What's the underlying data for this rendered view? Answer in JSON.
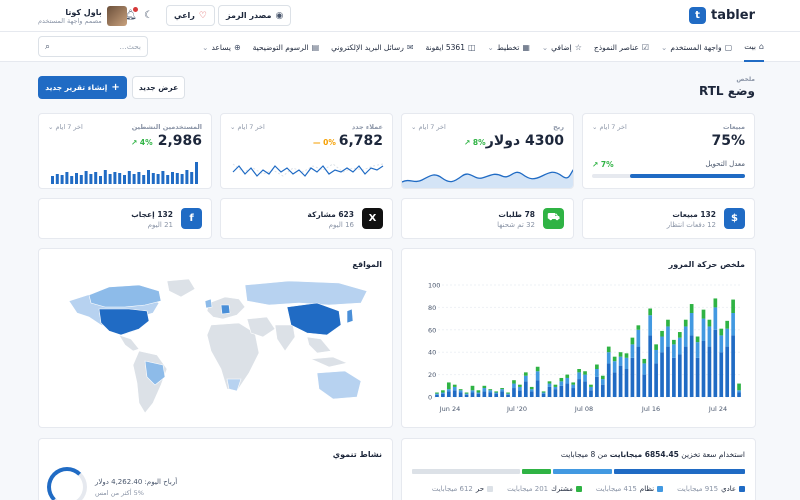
{
  "brand": {
    "name": "tabler",
    "mark": "t"
  },
  "header": {
    "source_btn": "مصدر الرمز",
    "sponsor_btn": "راعي",
    "user": {
      "name": "باول كوتا",
      "role": "مصمم واجهة المستخدم"
    }
  },
  "nav": {
    "items": [
      {
        "label": "بيت",
        "icon": "home-icon",
        "glyph": "⌂"
      },
      {
        "label": "واجهة المستخدم",
        "icon": "package-icon",
        "glyph": "▢",
        "dropdown": true
      },
      {
        "label": "عناصر النموذج",
        "icon": "checkbox-icon",
        "glyph": "☑"
      },
      {
        "label": "إضافي",
        "icon": "star-icon",
        "glyph": "☆",
        "dropdown": true
      },
      {
        "label": "تخطيط",
        "icon": "layout-icon",
        "glyph": "▦",
        "dropdown": true
      },
      {
        "label": "5361 ايقونة",
        "icon": "ghost-icon",
        "glyph": "◫"
      },
      {
        "label": "رسائل البريد الإلكتروني",
        "icon": "mail-icon",
        "glyph": "✉"
      },
      {
        "label": "الرسوم التوضيحية",
        "icon": "file-icon",
        "glyph": "▤"
      },
      {
        "label": "يساعد",
        "icon": "lifebuoy-icon",
        "glyph": "⊕",
        "dropdown": true
      }
    ],
    "search_placeholder": "بحث..."
  },
  "page": {
    "pretitle": "ملخص",
    "title": "وضع RTL",
    "btn_new": "إنشاء تقرير جديد",
    "btn_view": "عرض جديد"
  },
  "stats": [
    {
      "label": "مبيعات",
      "period": "اخر 7 ايام",
      "value": "75%",
      "sub": "معدل التحويل",
      "trend": "7%",
      "trend_dir": "up",
      "progress": 0.75
    },
    {
      "label": "ربح",
      "period": "اخر 7 ايام",
      "value": "4300 دولار",
      "trend": "8%",
      "trend_dir": "up"
    },
    {
      "label": "عملاء جدد",
      "period": "اخر 7 ايام",
      "value": "6,782",
      "trend": "0%",
      "trend_dir": "flat"
    },
    {
      "label": "المستخدمين النشطين",
      "period": "اخر 7 ايام",
      "value": "2,986",
      "trend": "4%",
      "trend_dir": "up"
    }
  ],
  "mini": [
    {
      "title": "132 مبيعات",
      "sub": "12 دفعات انتظار",
      "icon": "dollar-icon",
      "glyph": "$",
      "color": "#206bc4"
    },
    {
      "title": "78 طلبات",
      "sub": "32 تم شحنها",
      "icon": "cart-icon",
      "glyph": "⛟",
      "color": "#2fb344"
    },
    {
      "title": "623 مشاركة",
      "sub": "16 اليوم",
      "icon": "x-logo-icon",
      "glyph": "X",
      "color": "#111"
    },
    {
      "title": "132 إعجاب",
      "sub": "21 اليوم",
      "icon": "facebook-icon",
      "glyph": "f",
      "color": "#206bc4"
    }
  ],
  "traffic": {
    "title": "ملخص حركة المرور",
    "chart_data": {
      "type": "bar",
      "stacked": true,
      "ylim": [
        0,
        100
      ],
      "yticks": [
        0,
        20,
        40,
        60,
        80,
        100
      ],
      "xtick_labels": [
        "Jun 24",
        "Jul '20",
        "Jul 08",
        "Jul 16",
        "Jul 24"
      ],
      "series": [
        {
          "color": "#206bc4",
          "values": [
            2,
            3,
            5,
            6,
            4,
            2,
            4,
            3,
            5,
            4,
            3,
            5,
            2,
            8,
            6,
            14,
            5,
            15,
            3,
            9,
            7,
            10,
            12,
            8,
            16,
            14,
            6,
            18,
            11,
            30,
            22,
            28,
            25,
            35,
            45,
            20,
            55,
            30,
            40,
            45,
            35,
            38,
            45,
            55,
            35,
            50,
            45,
            60,
            40,
            45,
            55,
            4
          ]
        },
        {
          "color": "#4299e1",
          "values": [
            1,
            1,
            2,
            3,
            2,
            1,
            2,
            1,
            3,
            2,
            1,
            2,
            1,
            4,
            3,
            5,
            2,
            8,
            1,
            3,
            2,
            4,
            5,
            3,
            6,
            6,
            3,
            7,
            5,
            10,
            10,
            8,
            10,
            12,
            15,
            10,
            18,
            12,
            14,
            18,
            12,
            15,
            18,
            20,
            14,
            20,
            18,
            20,
            15,
            16,
            20,
            2
          ]
        },
        {
          "color": "#2fb344",
          "values": [
            1,
            2,
            6,
            2,
            1,
            1,
            4,
            2,
            2,
            1,
            1,
            1,
            1,
            3,
            2,
            3,
            2,
            4,
            1,
            2,
            2,
            3,
            3,
            2,
            3,
            3,
            2,
            4,
            3,
            5,
            4,
            4,
            4,
            6,
            4,
            4,
            6,
            5,
            5,
            6,
            4,
            5,
            6,
            8,
            5,
            8,
            6,
            8,
            6,
            7,
            12,
            6
          ]
        }
      ]
    }
  },
  "locations": {
    "title": "المواقع"
  },
  "storage": {
    "title_prefix": "استخدام سعة تخزين",
    "used": "6854.45 ميجابايت",
    "title_suffix": "من 8 ميجابايت",
    "segments": [
      {
        "label": "عادي",
        "value": "915 ميجابايت",
        "color": "#206bc4",
        "fraction": 0.4
      },
      {
        "label": "نظام",
        "value": "415 ميجابايت",
        "color": "#4299e1",
        "fraction": 0.18
      },
      {
        "label": "مشترك",
        "value": "201 ميجابايت",
        "color": "#2fb344",
        "fraction": 0.09
      },
      {
        "label": "حر",
        "value": "612 ميجابايت",
        "color": "#dce1e7",
        "fraction": 0.33
      }
    ]
  },
  "growth": {
    "title": "نشاط تنموي",
    "line1": "أرباح اليوم: 4,262.40 دولار",
    "line2": "5% أكثر من امس"
  }
}
